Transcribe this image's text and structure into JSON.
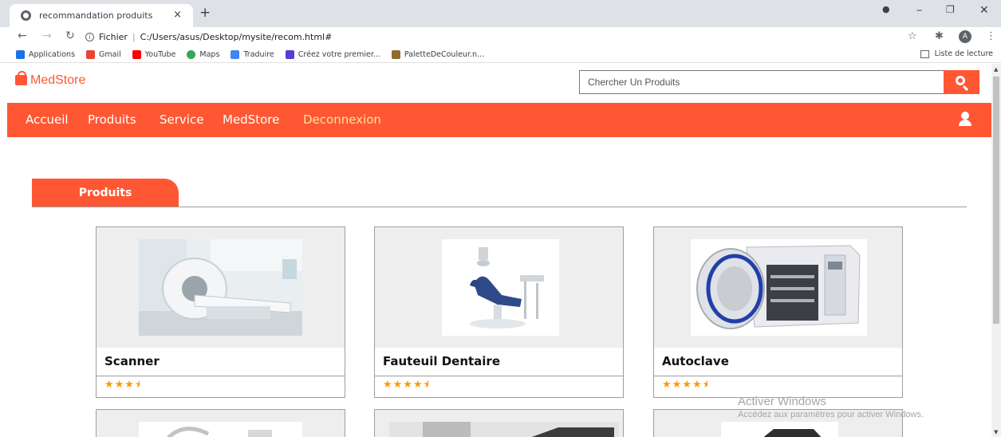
{
  "browser": {
    "tab_title": "recommandation produits",
    "tab_close": "×",
    "new_tab": "+",
    "address_label": "Fichier",
    "address_url": "C:/Users/asus/Desktop/mysite/recom.html#",
    "bookmarks": [
      {
        "label": "Applications",
        "icon": "apps-grid-icon",
        "color": "#1a73e8"
      },
      {
        "label": "Gmail",
        "icon": "gmail-icon",
        "color": "#ea4335"
      },
      {
        "label": "YouTube",
        "icon": "youtube-icon",
        "color": "#ff0000"
      },
      {
        "label": "Maps",
        "icon": "maps-icon",
        "color": "#34a853"
      },
      {
        "label": "Traduire",
        "icon": "translate-icon",
        "color": "#4285f4"
      },
      {
        "label": "Créez votre premier...",
        "icon": "bookmark-icon",
        "color": "#5b3bd6"
      },
      {
        "label": "PaletteDeCouleur.n...",
        "icon": "palette-icon",
        "color": "#8e6b2e"
      }
    ],
    "reading_list": "Liste de lecture",
    "avatar_letter": "A"
  },
  "site": {
    "logo_text": "MedStore",
    "search_placeholder": "Chercher Un Produits",
    "nav": [
      "Accueil",
      "Produits",
      "Service",
      "MedStore",
      "Deconnexion"
    ],
    "accent_color": "#ff5733",
    "section_title": "Produits"
  },
  "products": [
    {
      "name": "Scanner",
      "rating": 3.5
    },
    {
      "name": "Fauteuil Dentaire",
      "rating": 4.5
    },
    {
      "name": "Autoclave",
      "rating": 4.5
    }
  ],
  "watermark": {
    "line1": "Activer Windows",
    "line2": "Accédez aux paramètres pour activer Windows."
  }
}
